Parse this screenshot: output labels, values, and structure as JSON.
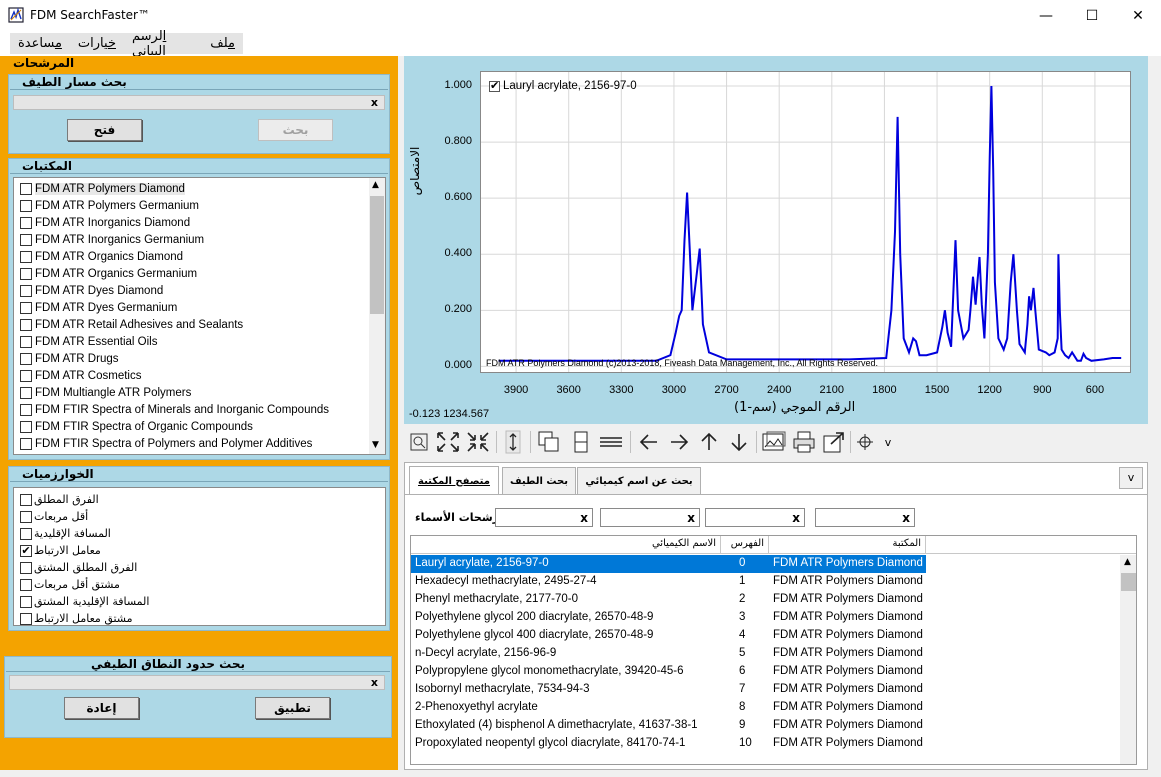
{
  "window": {
    "title": "FDM SearchFaster™",
    "min": "—",
    "max": "☐",
    "close": "✕"
  },
  "menu": [
    "ملف",
    "الرسم البياني",
    "خيارات",
    "مساعدة"
  ],
  "left": {
    "filters_title": "المرشحات",
    "path_search": {
      "title": "بحث مسار الطيف",
      "clear": "x",
      "open_btn": "فتح",
      "search_btn": "بحث"
    },
    "libraries": {
      "title": "المكتبات",
      "items": [
        "FDM ATR Polymers Diamond",
        "FDM ATR Polymers Germanium",
        "FDM ATR Inorganics Diamond",
        "FDM ATR Inorganics Germanium",
        "FDM ATR Organics Diamond",
        "FDM ATR Organics Germanium",
        "FDM ATR Dyes Diamond",
        "FDM ATR Dyes Germanium",
        "FDM ATR Retail Adhesives and Sealants",
        "FDM ATR Essential Oils",
        "FDM ATR Drugs",
        "FDM ATR Cosmetics",
        "FDM Multiangle ATR Polymers",
        "FDM FTIR Spectra of Minerals and Inorganic Compounds",
        "FDM FTIR Spectra of Organic Compounds",
        "FDM FTIR Spectra of Polymers and Polymer Additives"
      ]
    },
    "algorithms": {
      "title": "الخوارزميات",
      "items": [
        {
          "label": "الفرق المطلق",
          "checked": false
        },
        {
          "label": "أقل مربعات",
          "checked": false
        },
        {
          "label": "المسافة الإقليدية",
          "checked": false
        },
        {
          "label": "معامل الارتباط",
          "checked": true
        },
        {
          "label": "الفرق المطلق المشتق",
          "checked": false
        },
        {
          "label": "مشتق أقل مربعات",
          "checked": false
        },
        {
          "label": "المسافة الإقليدية المشتق",
          "checked": false
        },
        {
          "label": "مشتق معامل الارتباط",
          "checked": false
        }
      ]
    },
    "range_search": {
      "title": "بحث حدود النطاق الطيفي",
      "clear": "x",
      "reset_btn": "إعادة",
      "apply_btn": "تطبيق"
    }
  },
  "chart_data": {
    "type": "line",
    "legend": "Lauryl acrylate, 2156-97-0",
    "legend_checked": true,
    "copyright": "FDM ATR Polymers Diamond (c)2013-2018, Fiveash Data Management, Inc., All Rights Reserved.",
    "ylabel": "الامتصاص",
    "xlabel": "(الرقم الموجي (سم-1",
    "coords": "-0.123 1234.567",
    "x_ticks": [
      "3900",
      "3600",
      "3300",
      "3000",
      "2700",
      "2400",
      "2100",
      "1800",
      "1500",
      "1200",
      "900",
      "600"
    ],
    "y_ticks": [
      "1.000",
      "0.800",
      "0.600",
      "0.400",
      "0.200",
      "0.000"
    ],
    "xlim": [
      4100,
      400
    ],
    "ylim": [
      -0.02,
      1.05
    ],
    "series_color": "#0000dd",
    "series": [
      {
        "points": [
          [
            4000,
            0.02
          ],
          [
            3500,
            0.02
          ],
          [
            3100,
            0.02
          ],
          [
            3020,
            0.04
          ],
          [
            2990,
            0.12
          ],
          [
            2970,
            0.18
          ],
          [
            2956,
            0.2
          ],
          [
            2940,
            0.45
          ],
          [
            2925,
            0.62
          ],
          [
            2910,
            0.42
          ],
          [
            2895,
            0.2
          ],
          [
            2872,
            0.32
          ],
          [
            2853,
            0.42
          ],
          [
            2835,
            0.15
          ],
          [
            2800,
            0.05
          ],
          [
            2700,
            0.025
          ],
          [
            2000,
            0.025
          ],
          [
            1790,
            0.03
          ],
          [
            1760,
            0.2
          ],
          [
            1740,
            0.48
          ],
          [
            1725,
            0.89
          ],
          [
            1710,
            0.4
          ],
          [
            1690,
            0.1
          ],
          [
            1660,
            0.05
          ],
          [
            1636,
            0.1
          ],
          [
            1620,
            0.09
          ],
          [
            1600,
            0.04
          ],
          [
            1560,
            0.04
          ],
          [
            1500,
            0.05
          ],
          [
            1470,
            0.14
          ],
          [
            1455,
            0.2
          ],
          [
            1440,
            0.12
          ],
          [
            1420,
            0.07
          ],
          [
            1408,
            0.25
          ],
          [
            1395,
            0.45
          ],
          [
            1380,
            0.2
          ],
          [
            1350,
            0.1
          ],
          [
            1330,
            0.12
          ],
          [
            1320,
            0.13
          ],
          [
            1310,
            0.2
          ],
          [
            1295,
            0.32
          ],
          [
            1280,
            0.22
          ],
          [
            1270,
            0.3
          ],
          [
            1258,
            0.39
          ],
          [
            1245,
            0.22
          ],
          [
            1230,
            0.1
          ],
          [
            1210,
            0.4
          ],
          [
            1200,
            0.74
          ],
          [
            1190,
            1.0
          ],
          [
            1180,
            0.7
          ],
          [
            1170,
            0.3
          ],
          [
            1150,
            0.1
          ],
          [
            1120,
            0.06
          ],
          [
            1100,
            0.1
          ],
          [
            1080,
            0.3
          ],
          [
            1065,
            0.4
          ],
          [
            1045,
            0.2
          ],
          [
            1030,
            0.08
          ],
          [
            1000,
            0.05
          ],
          [
            985,
            0.15
          ],
          [
            975,
            0.25
          ],
          [
            965,
            0.2
          ],
          [
            950,
            0.28
          ],
          [
            940,
            0.2
          ],
          [
            920,
            0.06
          ],
          [
            880,
            0.05
          ],
          [
            860,
            0.04
          ],
          [
            830,
            0.05
          ],
          [
            812,
            0.1
          ],
          [
            808,
            0.4
          ],
          [
            800,
            0.2
          ],
          [
            790,
            0.06
          ],
          [
            770,
            0.04
          ],
          [
            750,
            0.03
          ],
          [
            730,
            0.05
          ],
          [
            720,
            0.04
          ],
          [
            700,
            0.02
          ],
          [
            680,
            0.02
          ],
          [
            665,
            0.045
          ],
          [
            650,
            0.03
          ],
          [
            620,
            0.02
          ],
          [
            550,
            0.025
          ],
          [
            500,
            0.03
          ],
          [
            450,
            0.03
          ]
        ]
      }
    ]
  },
  "tabs": [
    "متصفح المكتبة",
    "بحث الطيف",
    "بحث عن اسم كيميائي"
  ],
  "tab_overflow": "v",
  "name_filters_label": "مرشحات الأسماء",
  "filter_clear": "x",
  "table": {
    "headers": [
      "الاسم الكيميائي",
      "الفهرس",
      "المكتبة"
    ],
    "rows": [
      [
        "Lauryl acrylate, 2156-97-0",
        "0",
        "FDM ATR Polymers Diamond"
      ],
      [
        "Hexadecyl methacrylate, 2495-27-4",
        "1",
        "FDM ATR Polymers Diamond"
      ],
      [
        "Phenyl methacrylate, 2177-70-0",
        "2",
        "FDM ATR Polymers Diamond"
      ],
      [
        "Polyethylene glycol 200 diacrylate, 26570-48-9",
        "3",
        "FDM ATR Polymers Diamond"
      ],
      [
        "Polyethylene glycol 400 diacrylate, 26570-48-9",
        "4",
        "FDM ATR Polymers Diamond"
      ],
      [
        "n-Decyl acrylate, 2156-96-9",
        "5",
        "FDM ATR Polymers Diamond"
      ],
      [
        "Polypropylene glycol monomethacrylate, 39420-45-6",
        "6",
        "FDM ATR Polymers Diamond"
      ],
      [
        "Isobornyl methacrylate, 7534-94-3",
        "7",
        "FDM ATR Polymers Diamond"
      ],
      [
        "2-Phenoxyethyl acrylate",
        "8",
        "FDM ATR Polymers Diamond"
      ],
      [
        "Ethoxylated (4) bisphenol A dimethacrylate, 41637-38-1",
        "9",
        "FDM ATR Polymers Diamond"
      ],
      [
        "Propoxylated neopentyl glycol diacrylate, 84170-74-1",
        "10",
        "FDM ATR Polymers Diamond"
      ]
    ]
  }
}
